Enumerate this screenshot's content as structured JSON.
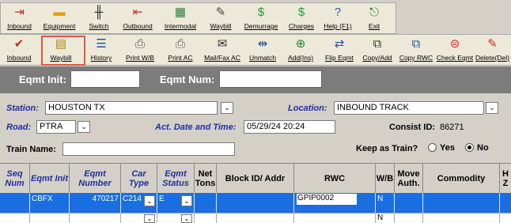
{
  "toolbar1": [
    {
      "label": "Inbound",
      "icon": "inbound-icon",
      "glyph": "⇥",
      "color": "#c0302a"
    },
    {
      "label": "Equipment",
      "icon": "railcar-icon",
      "glyph": "▬",
      "color": "#e0a000"
    },
    {
      "label": "Switch",
      "icon": "track-switch-icon",
      "glyph": "╫",
      "color": "#222"
    },
    {
      "label": "Outbound",
      "icon": "outbound-icon",
      "glyph": "⇤",
      "color": "#c0302a"
    },
    {
      "label": "Intermodal",
      "icon": "chart-icon",
      "glyph": "▦",
      "color": "#2d7f3e"
    },
    {
      "label": "Waybill",
      "icon": "pencil-icon",
      "glyph": "✎",
      "color": "#444"
    },
    {
      "label": "Demurrage",
      "icon": "dollar-icon",
      "glyph": "$",
      "color": "#1f9a3a"
    },
    {
      "label": "Charges",
      "icon": "money-bag-icon",
      "glyph": "$",
      "color": "#1f9a3a"
    },
    {
      "label": "Help (F1)",
      "icon": "help-icon",
      "glyph": "?",
      "color": "#1f5ec8"
    },
    {
      "label": "Exit",
      "icon": "exit-door-icon",
      "glyph": "⎋",
      "color": "#2d7f3e"
    }
  ],
  "toolbar2": [
    {
      "label": "Inbound",
      "icon": "checkmark-icon",
      "glyph": "✔",
      "color": "#c0302a"
    },
    {
      "label": "Waybill",
      "icon": "waybill-document-icon",
      "glyph": "▤",
      "color": "#b8860b"
    },
    {
      "label": "History",
      "icon": "history-icon",
      "glyph": "☰",
      "color": "#1f4fa0"
    },
    {
      "label": "Print W/B",
      "icon": "printer-icon",
      "glyph": "⎙",
      "color": "#555"
    },
    {
      "label": "Print AC",
      "icon": "printer-icon",
      "glyph": "⎙",
      "color": "#555"
    },
    {
      "label": "Mail/Fax AC",
      "icon": "fax-icon",
      "glyph": "✉",
      "color": "#333"
    },
    {
      "label": "Unmatch",
      "icon": "unmatch-icon",
      "glyph": "⇹",
      "color": "#1f4fa0"
    },
    {
      "label": "Add(Ins)",
      "icon": "add-icon",
      "glyph": "⊕",
      "color": "#2d7f3e"
    },
    {
      "label": "Flip Eqmt",
      "icon": "flip-icon",
      "glyph": "⇄",
      "color": "#1f4fa0"
    },
    {
      "label": "Copy/Add",
      "icon": "copy-add-icon",
      "glyph": "⧉",
      "color": "#333"
    },
    {
      "label": "Copy RWC",
      "icon": "copy-rwc-icon",
      "glyph": "⧉",
      "color": "#1f4fa0"
    },
    {
      "label": "Check Eqmt",
      "icon": "check-eqmt-icon",
      "glyph": "⊜",
      "color": "#c0302a"
    },
    {
      "label": "Delete(Del)",
      "icon": "delete-icon",
      "glyph": "✎",
      "color": "#c0302a"
    }
  ],
  "eqmt": {
    "init_label": "Eqmt Init:",
    "init_value": "",
    "num_label": "Eqmt Num:",
    "num_value": ""
  },
  "form": {
    "station_label": "Station:",
    "station_value": "HOUSTON TX",
    "location_label": "Location:",
    "location_value": "INBOUND TRACK",
    "road_label": "Road:",
    "road_value": "PTRA",
    "actdate_label": "Act. Date and Time:",
    "actdate_value": "05/29/24 20:24",
    "consist_label": "Consist ID:",
    "consist_value": "86271",
    "train_label": "Train Name:",
    "train_value": "",
    "keep_label": "Keep as Train?",
    "yes_label": "Yes",
    "no_label": "No",
    "keep_selected": "No"
  },
  "grid": {
    "headers": [
      "Seq Num",
      "Eqmt Init",
      "Eqmt Number",
      "Car Type",
      "Eqmt Status",
      "Net Tons",
      "Block ID/ Addr",
      "RWC",
      "W/B",
      "Move Auth.",
      "Commodity",
      "H Z"
    ],
    "row": {
      "seq": "",
      "init": "CBFX",
      "number": "470217",
      "car_type": "C214",
      "status": "E",
      "net_tons": "",
      "block": "",
      "rwc": "GPIP0002",
      "wb": "N",
      "move": "",
      "commodity": "",
      "hz": ""
    },
    "row2": {
      "wb": "N"
    }
  },
  "colors": {
    "accent_blue": "#1a6fe0",
    "label_blue": "#1f2f9a",
    "highlight_red": "#e0554a"
  }
}
